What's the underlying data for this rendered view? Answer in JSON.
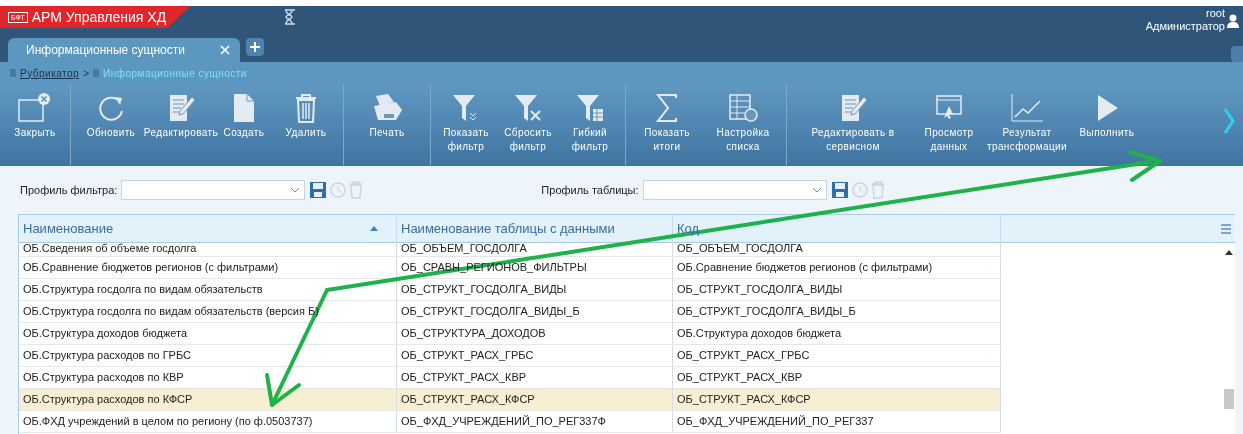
{
  "app": {
    "logo": "БФТ",
    "title": "АРМ Управления ХД"
  },
  "user": {
    "login": "root",
    "role": "Администратор"
  },
  "tabs": [
    {
      "label": "Информационные сущности",
      "selected": true
    }
  ],
  "breadcrumb": [
    {
      "label": "Рубрикатор",
      "link": true,
      "separator": ">"
    },
    {
      "label": "Информационные сущности",
      "link": false
    }
  ],
  "toolbar": [
    [
      {
        "label": "Закрыть",
        "kind": "close"
      }
    ],
    [
      {
        "label": "Обновить",
        "kind": "refresh"
      },
      {
        "label": "Редактировать",
        "kind": "edit"
      },
      {
        "label": "Создать",
        "kind": "create"
      },
      {
        "label": "Удалить",
        "kind": "delete"
      }
    ],
    [
      {
        "label": "Печать",
        "kind": "print"
      }
    ],
    [
      {
        "label": "Показать фильтр",
        "kind": "filter-show"
      },
      {
        "label": "Сбросить фильтр",
        "kind": "filter-reset"
      },
      {
        "label": "Гибкий фильтр",
        "kind": "filter-flex"
      }
    ],
    [
      {
        "label": "Показать итоги",
        "kind": "sum"
      },
      {
        "label": "Настройка списка",
        "kind": "list-settings"
      }
    ],
    [
      {
        "label": "Редактировать в сервисном",
        "kind": "edit"
      },
      {
        "label": "Просмотр данных",
        "kind": "view"
      },
      {
        "label": "Результат трансформации",
        "kind": "chart"
      },
      {
        "label": "Выполнить",
        "kind": "run"
      }
    ]
  ],
  "filter_profile": {
    "label": "Профиль фильтра:"
  },
  "table_profile": {
    "label": "Профиль таблицы:"
  },
  "table": {
    "columns": [
      {
        "label": "Наименование",
        "sorted": true
      },
      {
        "label": "Наименование таблицы с данными",
        "sorted": false
      },
      {
        "label": "Код",
        "sorted": false
      }
    ],
    "rows": [
      {
        "cells": [
          "ОБ.Сведения об объеме госдолга",
          "ОБ_ОБЪЕМ_ГОСДОЛГА",
          "ОБ_ОБЪЕМ_ГОСДОЛГА"
        ],
        "selected": false
      },
      {
        "cells": [
          "ОБ.Сравнение бюджетов регионов (с фильтрами)",
          "ОБ_СРАВН_РЕГИОНОВ_ФИЛЬТРЫ",
          "ОБ.Сравнение бюджетов регионов (с фильтрами)"
        ],
        "selected": false
      },
      {
        "cells": [
          "ОБ.Структура госдолга по видам обязательств",
          "ОБ_СТРУКТ_ГОСДОЛГА_ВИДЫ",
          "ОБ_СТРУКТ_ГОСДОЛГА_ВИДЫ"
        ],
        "selected": false
      },
      {
        "cells": [
          "ОБ.Структура госдолга по видам обязательств (версия Б)",
          "ОБ_СТРУКТ_ГОСДОЛГА_ВИДЫ_Б",
          "ОБ_СТРУКТ_ГОСДОЛГА_ВИДЫ_Б"
        ],
        "selected": false
      },
      {
        "cells": [
          "ОБ.Структура доходов бюджета",
          "ОБ_СТРУКТУРА_ДОХОДОВ",
          "ОБ.Структура доходов бюджета"
        ],
        "selected": false
      },
      {
        "cells": [
          "ОБ.Структура расходов по ГРБС",
          "ОБ_СТРУКТ_РАСХ_ГРБС",
          "ОБ_СТРУКТ_РАСХ_ГРБС"
        ],
        "selected": false
      },
      {
        "cells": [
          "ОБ.Структура расходов по КВР",
          "ОБ_СТРУКТ_РАСХ_КВР",
          "ОБ_СТРУКТ_РАСХ_КВР"
        ],
        "selected": false
      },
      {
        "cells": [
          "ОБ.Структура расходов по КФСР",
          "ОБ_СТРУКТ_РАСХ_КФСР",
          "ОБ_СТРУКТ_РАСХ_КФСР"
        ],
        "selected": true
      },
      {
        "cells": [
          "ОБ.ФХД учреждений в целом по региону (по ф.0503737)",
          "ОБ_ФХД_УЧРЕЖДЕНИЙ_ПО_РЕГ337Ф",
          "ОБ_ФХД_УЧРЕЖДЕНИЙ_ПО_РЕГ337"
        ],
        "selected": false
      }
    ]
  }
}
